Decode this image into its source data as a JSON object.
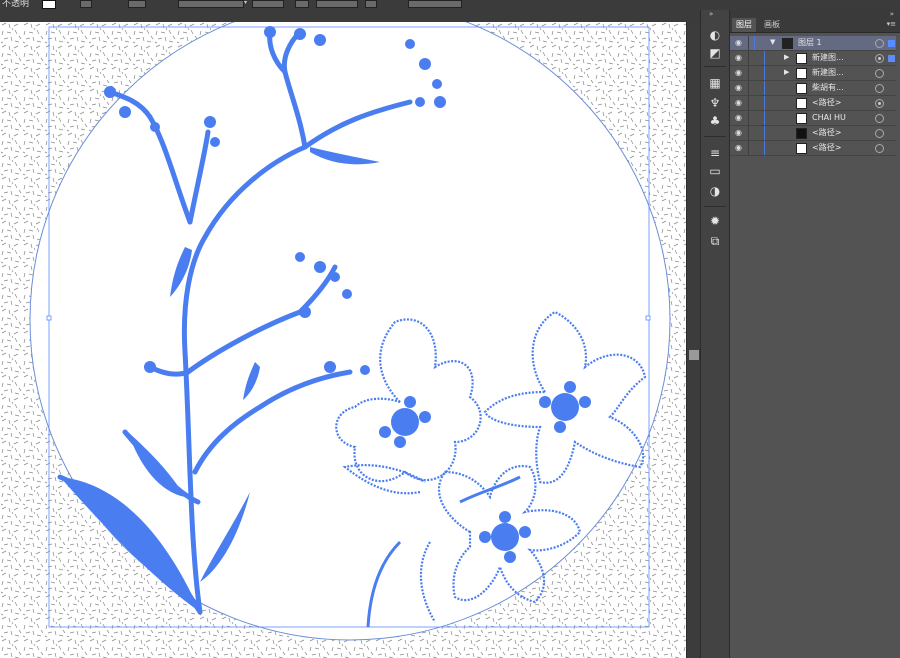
{
  "toolbar": {
    "partial_label": "不透明",
    "icons": [
      "swatch-icon",
      "dropdown-arrow-icon"
    ]
  },
  "panel": {
    "tabs": [
      {
        "label": "图层",
        "active": true
      },
      {
        "label": "画板",
        "active": false
      }
    ],
    "collapse_label": "»",
    "menu_label": "▾≡"
  },
  "layers": [
    {
      "label": "图层 1",
      "indent": 0,
      "expanded": true,
      "selected": true,
      "target": false,
      "sel_square": "filled"
    },
    {
      "label": "新建图...",
      "indent": 1,
      "expanded": false,
      "selected": false,
      "target": "double",
      "sel_square": "filled"
    },
    {
      "label": "新建图...",
      "indent": 1,
      "expanded": false,
      "selected": false,
      "target": false,
      "sel_square": "none"
    },
    {
      "label": "柴胡有...",
      "indent": 1,
      "expanded": null,
      "selected": false,
      "target": false,
      "sel_square": "none"
    },
    {
      "label": "<路径>",
      "indent": 1,
      "expanded": null,
      "selected": false,
      "target": "filled",
      "sel_square": "none"
    },
    {
      "label": "CHAI HU",
      "indent": 1,
      "expanded": null,
      "selected": false,
      "target": false,
      "sel_square": "none"
    },
    {
      "label": "<路径>",
      "indent": 1,
      "expanded": null,
      "selected": false,
      "target": false,
      "sel_square": "none"
    },
    {
      "label": "<路径>",
      "indent": 1,
      "expanded": null,
      "selected": false,
      "target": false,
      "sel_square": "none"
    }
  ],
  "colors": {
    "artwork_blue": "#4a7ef0",
    "selection_blue": "#5b8cff",
    "panel_bg": "#535353"
  }
}
